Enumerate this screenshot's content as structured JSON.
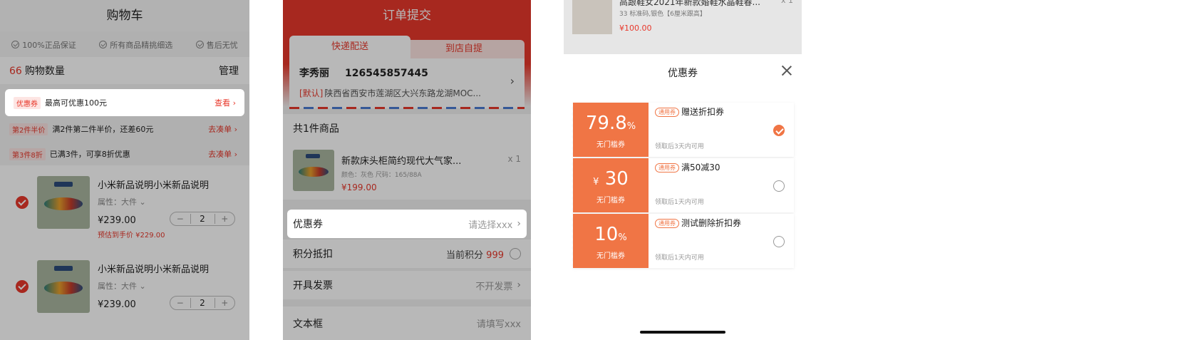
{
  "cart": {
    "title": "购物车",
    "guarantees": [
      "100%正品保证",
      "所有商品精挑细选",
      "售后无忧"
    ],
    "count": "66",
    "count_label": "购物数量",
    "manage": "管理",
    "coupon_tag": "优惠券",
    "coupon_text": "最高可优惠100元",
    "coupon_link": "查看 ›",
    "promos": [
      {
        "tag": "第2件半价",
        "text": "满2件第二件半价，还差60元",
        "link": "去凑单 ›"
      },
      {
        "tag": "第3件8折",
        "text": "已满3件，可享8折优惠",
        "link": "去凑单 ›"
      }
    ],
    "items": [
      {
        "title": "小米新品说明小米新品说明",
        "attr": "属性：大件 ⌄",
        "price": "¥239.00",
        "qty": "2",
        "est": "预估到手价 ¥229.00"
      },
      {
        "title": "小米新品说明小米新品说明",
        "attr": "属性：大件 ⌄",
        "price": "¥239.00",
        "qty": "2",
        "est": ""
      }
    ],
    "stepper": {
      "minus": "−",
      "plus": "+"
    }
  },
  "order": {
    "title": "订单提交",
    "tab_delivery": "快递配送",
    "tab_pickup": "到店自提",
    "recipient": "李秀丽",
    "phone": "126545857445",
    "default_tag": "[默认]",
    "address": "陕西省西安市莲湖区大兴东路龙湖MOC...",
    "goods_count": "共1件商品",
    "goods_title": "新款床头柜简约现代大气家...",
    "goods_spec": "颜色：灰色  尺码：165/88A",
    "goods_price": "¥199.00",
    "goods_qty": "x 1",
    "coupon_label": "优惠券",
    "coupon_value": "请选择xxx",
    "points_label": "积分抵扣",
    "points_value_label": "当前积分",
    "points_value": "999",
    "invoice_label": "开具发票",
    "invoice_value": "不开发票",
    "textbox_label": "文本框",
    "textbox_value": "请填写xxx"
  },
  "coupon_sheet": {
    "bg_title": "高跟鞋女2021年新款婚鞋水晶鞋春...",
    "bg_spec": "33 标准码,银色【6厘米跟高】",
    "bg_price": "¥100.00",
    "bg_qty": "x 1",
    "title": "优惠券",
    "coupons": [
      {
        "value": "79.8",
        "unit": "%",
        "prefix": "",
        "condition": "无门槛券",
        "tag": "通用券",
        "name": "赠送折扣券",
        "validity": "领取后3天内可用",
        "selected": true
      },
      {
        "value": "30",
        "unit": "",
        "prefix": "¥",
        "condition": "无门槛券",
        "tag": "通用券",
        "name": "满50减30",
        "validity": "领取后1天内可用",
        "selected": false
      },
      {
        "value": "10",
        "unit": "%",
        "prefix": "",
        "condition": "无门槛券",
        "tag": "通用券",
        "name": "测试删除折扣券",
        "validity": "领取后1天内可用",
        "selected": false
      }
    ]
  },
  "colors": {
    "accent": "#e8382b",
    "coupon_orange": "#f07545"
  }
}
